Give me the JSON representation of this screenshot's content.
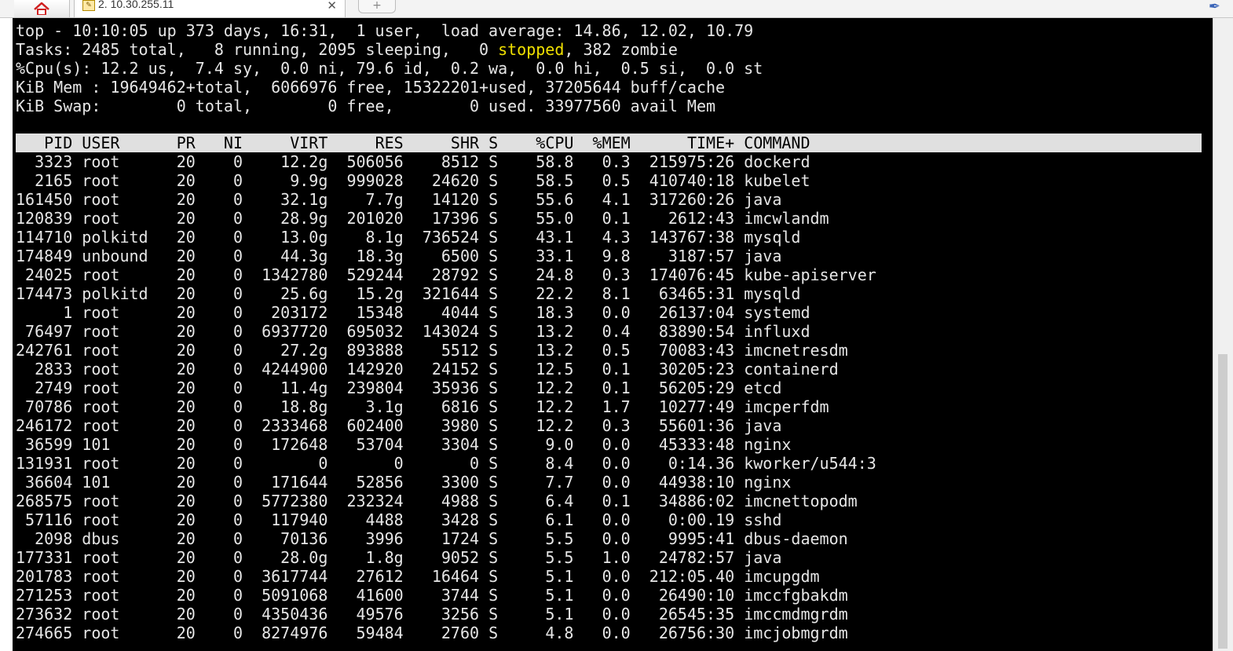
{
  "tabs": {
    "home_icon": "home-icon",
    "session_title": "2. 10.30.255.11",
    "session_icon_glyph": "✎",
    "close_glyph": "✕",
    "new_tab_glyph": "+",
    "attach_glyph": "✒"
  },
  "summary": {
    "line1": "top - 10:10:05 up 373 days, 16:31,  1 user,  load average: 14.86, 12.02, 10.79",
    "line2_pre": "Tasks: 2485 total,   8 running, 2095 sleeping,   0 ",
    "line2_stopped": "stopped",
    "line2_post": ", 382 zombie",
    "line3": "%Cpu(s): 12.2 us,  7.4 sy,  0.0 ni, 79.6 id,  0.2 wa,  0.0 hi,  0.5 si,  0.0 st",
    "line4": "KiB Mem : 19649462+total,  6066976 free, 15322201+used, 37205644 buff/cache",
    "line5": "KiB Swap:        0 total,        0 free,        0 used. 33977560 avail Mem"
  },
  "columns": [
    "PID",
    "USER",
    "PR",
    "NI",
    "VIRT",
    "RES",
    "SHR",
    "S",
    "%CPU",
    "%MEM",
    "TIME+",
    "COMMAND"
  ],
  "processes": [
    {
      "pid": "3323",
      "user": "root",
      "pr": "20",
      "ni": "0",
      "virt": "12.2g",
      "res": "506056",
      "shr": "8512",
      "s": "S",
      "cpu": "58.8",
      "mem": "0.3",
      "time": "215975:26",
      "cmd": "dockerd"
    },
    {
      "pid": "2165",
      "user": "root",
      "pr": "20",
      "ni": "0",
      "virt": "9.9g",
      "res": "999028",
      "shr": "24620",
      "s": "S",
      "cpu": "58.5",
      "mem": "0.5",
      "time": "410740:18",
      "cmd": "kubelet"
    },
    {
      "pid": "161450",
      "user": "root",
      "pr": "20",
      "ni": "0",
      "virt": "32.1g",
      "res": "7.7g",
      "shr": "14120",
      "s": "S",
      "cpu": "55.6",
      "mem": "4.1",
      "time": "317260:26",
      "cmd": "java"
    },
    {
      "pid": "120839",
      "user": "root",
      "pr": "20",
      "ni": "0",
      "virt": "28.9g",
      "res": "201020",
      "shr": "17396",
      "s": "S",
      "cpu": "55.0",
      "mem": "0.1",
      "time": "2612:43",
      "cmd": "imcwlandm"
    },
    {
      "pid": "114710",
      "user": "polkitd",
      "pr": "20",
      "ni": "0",
      "virt": "13.0g",
      "res": "8.1g",
      "shr": "736524",
      "s": "S",
      "cpu": "43.1",
      "mem": "4.3",
      "time": "143767:38",
      "cmd": "mysqld"
    },
    {
      "pid": "174849",
      "user": "unbound",
      "pr": "20",
      "ni": "0",
      "virt": "44.3g",
      "res": "18.3g",
      "shr": "6500",
      "s": "S",
      "cpu": "33.1",
      "mem": "9.8",
      "time": "3187:57",
      "cmd": "java"
    },
    {
      "pid": "24025",
      "user": "root",
      "pr": "20",
      "ni": "0",
      "virt": "1342780",
      "res": "529244",
      "shr": "28792",
      "s": "S",
      "cpu": "24.8",
      "mem": "0.3",
      "time": "174076:45",
      "cmd": "kube-apiserver"
    },
    {
      "pid": "174473",
      "user": "polkitd",
      "pr": "20",
      "ni": "0",
      "virt": "25.6g",
      "res": "15.2g",
      "shr": "321644",
      "s": "S",
      "cpu": "22.2",
      "mem": "8.1",
      "time": "63465:31",
      "cmd": "mysqld"
    },
    {
      "pid": "1",
      "user": "root",
      "pr": "20",
      "ni": "0",
      "virt": "203172",
      "res": "15348",
      "shr": "4044",
      "s": "S",
      "cpu": "18.3",
      "mem": "0.0",
      "time": "26137:04",
      "cmd": "systemd"
    },
    {
      "pid": "76497",
      "user": "root",
      "pr": "20",
      "ni": "0",
      "virt": "6937720",
      "res": "695032",
      "shr": "143024",
      "s": "S",
      "cpu": "13.2",
      "mem": "0.4",
      "time": "83890:54",
      "cmd": "influxd"
    },
    {
      "pid": "242761",
      "user": "root",
      "pr": "20",
      "ni": "0",
      "virt": "27.2g",
      "res": "893888",
      "shr": "5512",
      "s": "S",
      "cpu": "13.2",
      "mem": "0.5",
      "time": "70083:43",
      "cmd": "imcnetresdm"
    },
    {
      "pid": "2833",
      "user": "root",
      "pr": "20",
      "ni": "0",
      "virt": "4244900",
      "res": "142920",
      "shr": "24152",
      "s": "S",
      "cpu": "12.5",
      "mem": "0.1",
      "time": "30205:23",
      "cmd": "containerd"
    },
    {
      "pid": "2749",
      "user": "root",
      "pr": "20",
      "ni": "0",
      "virt": "11.4g",
      "res": "239804",
      "shr": "35936",
      "s": "S",
      "cpu": "12.2",
      "mem": "0.1",
      "time": "56205:29",
      "cmd": "etcd"
    },
    {
      "pid": "70786",
      "user": "root",
      "pr": "20",
      "ni": "0",
      "virt": "18.8g",
      "res": "3.1g",
      "shr": "6816",
      "s": "S",
      "cpu": "12.2",
      "mem": "1.7",
      "time": "10277:49",
      "cmd": "imcperfdm"
    },
    {
      "pid": "246172",
      "user": "root",
      "pr": "20",
      "ni": "0",
      "virt": "2333468",
      "res": "602400",
      "shr": "3980",
      "s": "S",
      "cpu": "12.2",
      "mem": "0.3",
      "time": "55601:36",
      "cmd": "java"
    },
    {
      "pid": "36599",
      "user": "101",
      "pr": "20",
      "ni": "0",
      "virt": "172648",
      "res": "53704",
      "shr": "3304",
      "s": "S",
      "cpu": "9.0",
      "mem": "0.0",
      "time": "45333:48",
      "cmd": "nginx"
    },
    {
      "pid": "131931",
      "user": "root",
      "pr": "20",
      "ni": "0",
      "virt": "0",
      "res": "0",
      "shr": "0",
      "s": "S",
      "cpu": "8.4",
      "mem": "0.0",
      "time": "0:14.36",
      "cmd": "kworker/u544:3"
    },
    {
      "pid": "36604",
      "user": "101",
      "pr": "20",
      "ni": "0",
      "virt": "171644",
      "res": "52856",
      "shr": "3300",
      "s": "S",
      "cpu": "7.7",
      "mem": "0.0",
      "time": "44938:10",
      "cmd": "nginx"
    },
    {
      "pid": "268575",
      "user": "root",
      "pr": "20",
      "ni": "0",
      "virt": "5772380",
      "res": "232324",
      "shr": "4988",
      "s": "S",
      "cpu": "6.4",
      "mem": "0.1",
      "time": "34886:02",
      "cmd": "imcnettopodm"
    },
    {
      "pid": "57116",
      "user": "root",
      "pr": "20",
      "ni": "0",
      "virt": "117940",
      "res": "4488",
      "shr": "3428",
      "s": "S",
      "cpu": "6.1",
      "mem": "0.0",
      "time": "0:00.19",
      "cmd": "sshd"
    },
    {
      "pid": "2098",
      "user": "dbus",
      "pr": "20",
      "ni": "0",
      "virt": "70136",
      "res": "3996",
      "shr": "1724",
      "s": "S",
      "cpu": "5.5",
      "mem": "0.0",
      "time": "9995:41",
      "cmd": "dbus-daemon"
    },
    {
      "pid": "177331",
      "user": "root",
      "pr": "20",
      "ni": "0",
      "virt": "28.0g",
      "res": "1.8g",
      "shr": "9052",
      "s": "S",
      "cpu": "5.5",
      "mem": "1.0",
      "time": "24782:57",
      "cmd": "java"
    },
    {
      "pid": "201783",
      "user": "root",
      "pr": "20",
      "ni": "0",
      "virt": "3617744",
      "res": "27612",
      "shr": "16464",
      "s": "S",
      "cpu": "5.1",
      "mem": "0.0",
      "time": "212:05.40",
      "cmd": "imcupgdm"
    },
    {
      "pid": "271253",
      "user": "root",
      "pr": "20",
      "ni": "0",
      "virt": "5091068",
      "res": "41600",
      "shr": "3744",
      "s": "S",
      "cpu": "5.1",
      "mem": "0.0",
      "time": "26490:10",
      "cmd": "imccfgbakdm"
    },
    {
      "pid": "273632",
      "user": "root",
      "pr": "20",
      "ni": "0",
      "virt": "4350436",
      "res": "49576",
      "shr": "3256",
      "s": "S",
      "cpu": "5.1",
      "mem": "0.0",
      "time": "26545:35",
      "cmd": "imccmdmgrdm"
    },
    {
      "pid": "274665",
      "user": "root",
      "pr": "20",
      "ni": "0",
      "virt": "8274976",
      "res": "59484",
      "shr": "2760",
      "s": "S",
      "cpu": "4.8",
      "mem": "0.0",
      "time": "26756:30",
      "cmd": "imcjobmgrdm"
    }
  ]
}
